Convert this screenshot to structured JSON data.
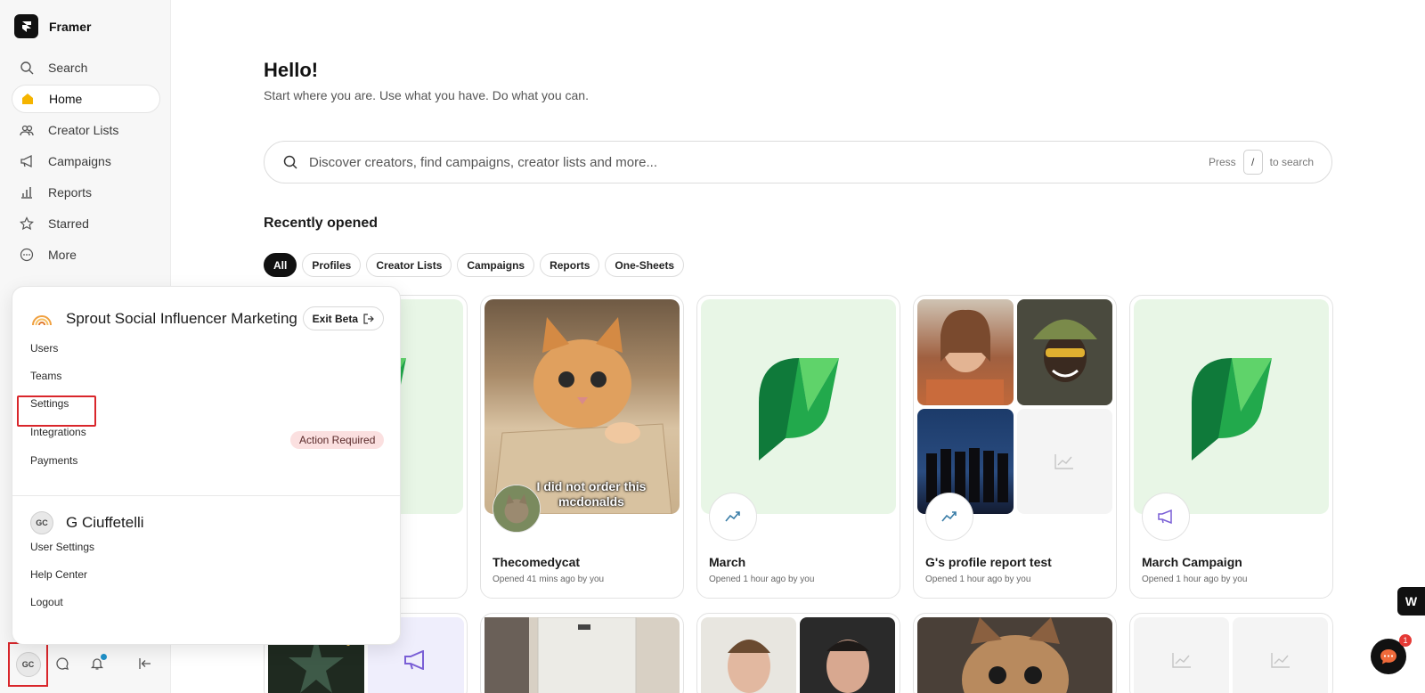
{
  "app": {
    "name": "Framer"
  },
  "nav": {
    "items": [
      {
        "label": "Search",
        "icon": "search-icon"
      },
      {
        "label": "Home",
        "icon": "home-icon",
        "active": true
      },
      {
        "label": "Creator Lists",
        "icon": "users-icon"
      },
      {
        "label": "Campaigns",
        "icon": "megaphone-icon"
      },
      {
        "label": "Reports",
        "icon": "bar-chart-icon"
      },
      {
        "label": "Starred",
        "icon": "star-icon"
      },
      {
        "label": "More",
        "icon": "more-icon"
      }
    ]
  },
  "sidebar_bottom": {
    "avatar_initials": "GC"
  },
  "popup": {
    "org_name": "Sprout Social Influencer Marketing",
    "exit_beta_label": "Exit Beta",
    "menu": [
      "Users",
      "Teams",
      "Settings",
      "Integrations",
      "Payments"
    ],
    "action_required_label": "Action Required",
    "user_initials": "GC",
    "user_name": "G Ciuffetelli",
    "user_menu": [
      "User Settings",
      "Help Center",
      "Logout"
    ]
  },
  "main": {
    "greeting": "Hello!",
    "subtitle": "Start where you are. Use what you have. Do what you can.",
    "search_placeholder": "Discover creators, find campaigns, creator lists and more...",
    "search_hint_press": "Press",
    "search_hint_key": "/",
    "search_hint_suffix": "to search",
    "recent_title": "Recently opened",
    "filters": [
      "All",
      "Profiles",
      "Creator Lists",
      "Campaigns",
      "Reports",
      "One-Sheets"
    ]
  },
  "cards": [
    {
      "title": "",
      "meta": ""
    },
    {
      "title": "Thecomedycat",
      "meta": "Opened 41 mins ago by you",
      "caption": "I did not order this mcdonalds"
    },
    {
      "title": "March",
      "meta": "Opened 1 hour ago by you"
    },
    {
      "title": "G's profile report test",
      "meta": "Opened 1 hour ago by you"
    },
    {
      "title": "March Campaign",
      "meta": "Opened 1 hour ago by you"
    }
  ],
  "chat_badge": "1",
  "colors": {
    "accent_green": "#1aa84f",
    "highlight_red": "#d9262b",
    "badge_pink": "#fbe0e0"
  }
}
